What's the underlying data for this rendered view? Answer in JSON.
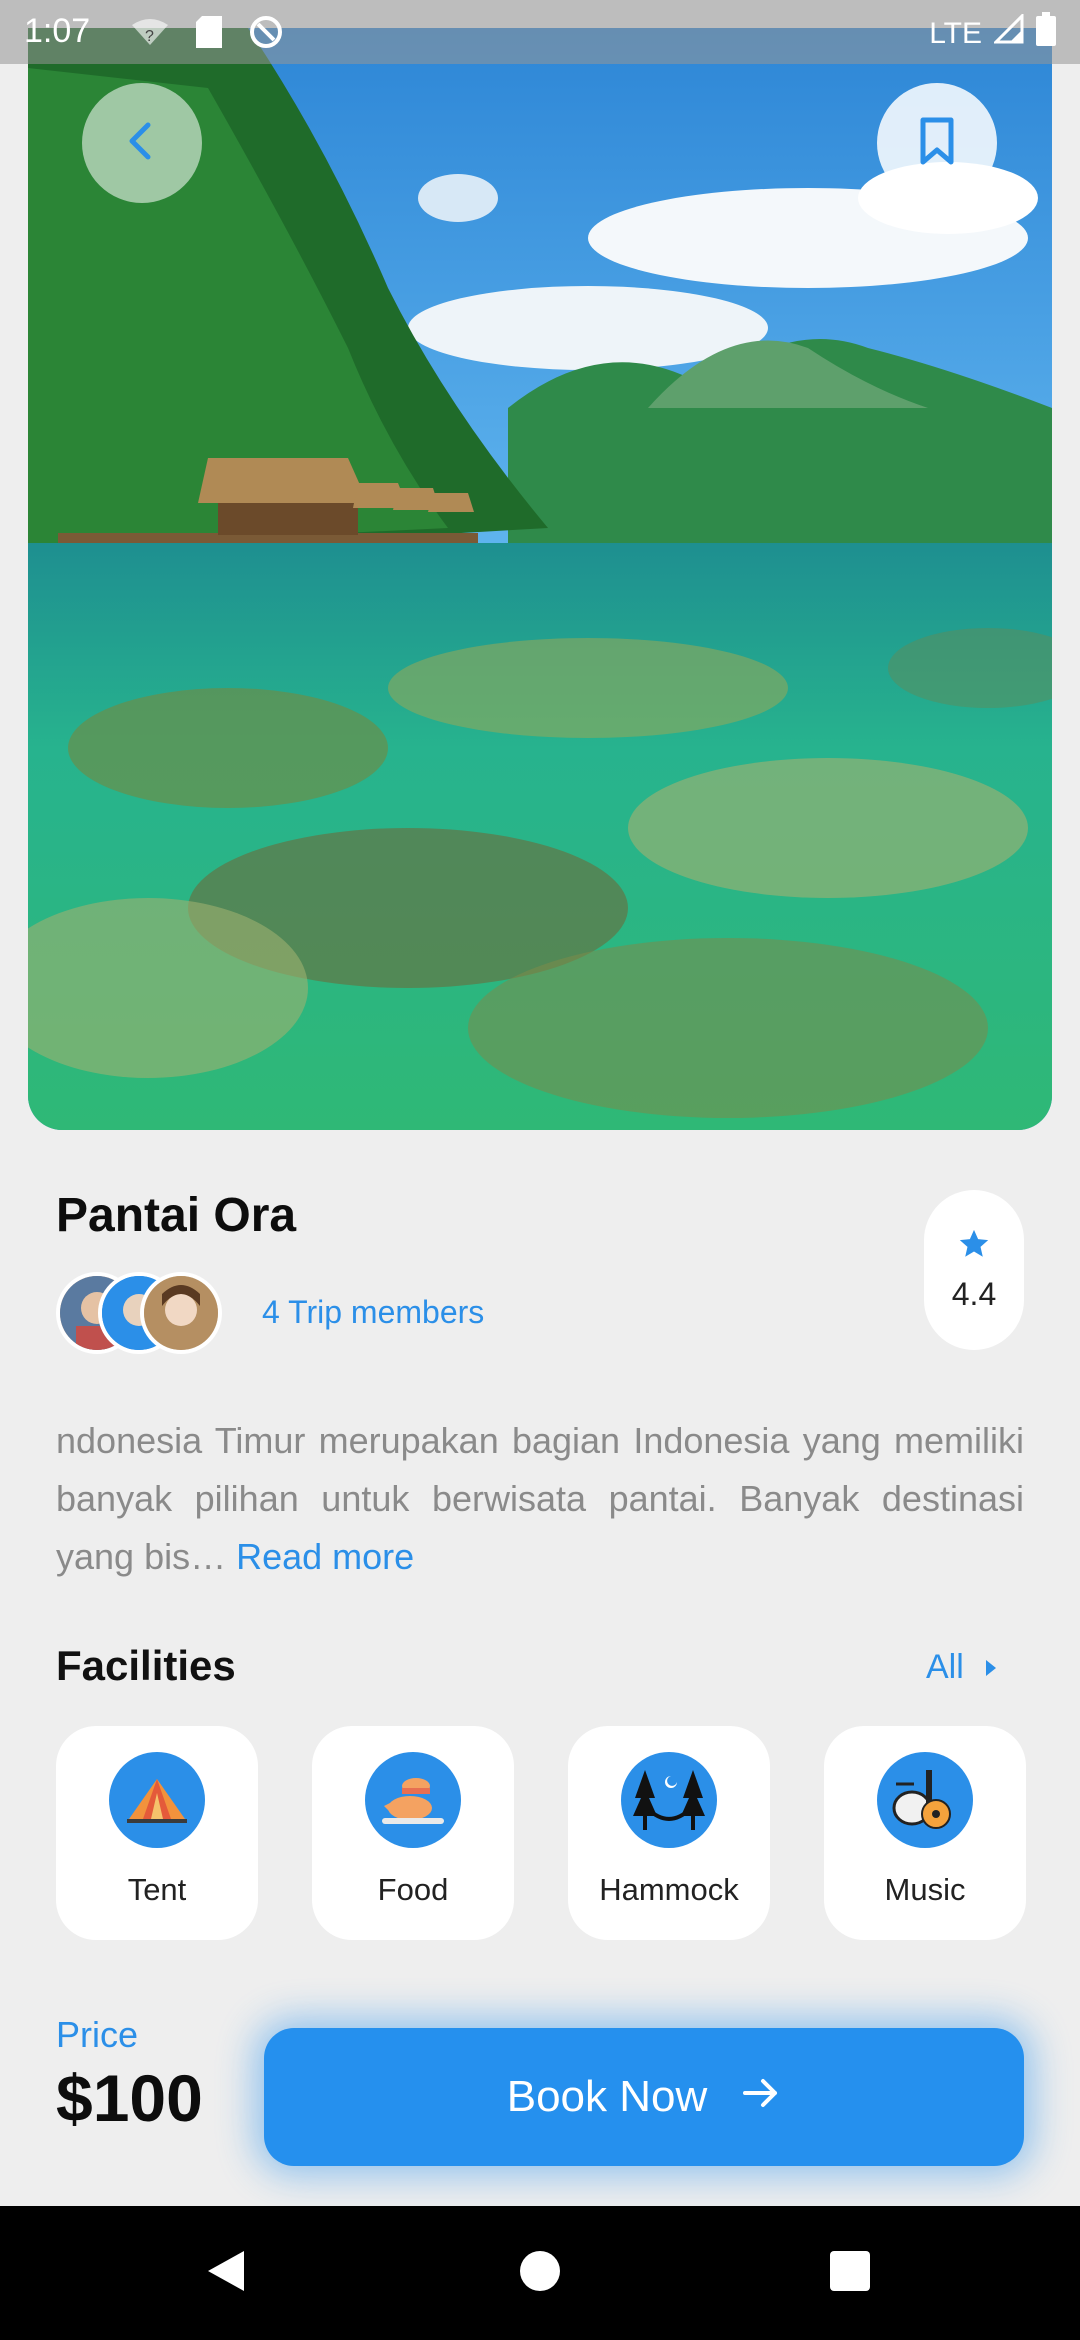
{
  "status_bar": {
    "time": "1:07",
    "network": "LTE",
    "icons": [
      "wifi-question-icon",
      "sd-card-icon",
      "sync-icon",
      "lte-signal-icon",
      "battery-icon"
    ]
  },
  "hero": {
    "icons": [
      "back-icon",
      "bookmark-icon"
    ]
  },
  "destination": {
    "title": "Pantai Ora",
    "members_label": "4 Trip members",
    "rating": "4.4",
    "description": "ndonesia Timur merupakan bagian Indonesia yang memiliki banyak pilihan untuk berwisata pantai. Banyak destinasi yang bis…",
    "read_more": "Read more"
  },
  "facilities": {
    "title": "Facilities",
    "all_label": "All",
    "items": [
      {
        "label": "Tent",
        "icon": "tent-icon"
      },
      {
        "label": "Food",
        "icon": "food-icon"
      },
      {
        "label": "Hammock",
        "icon": "hammock-icon"
      },
      {
        "label": "Music",
        "icon": "music-icon"
      }
    ]
  },
  "booking": {
    "price_label": "Price",
    "price": "$100",
    "button_label": "Book Now"
  },
  "colors": {
    "accent": "#2b8fe8",
    "background": "#eeeeee",
    "card": "#ffffff"
  }
}
